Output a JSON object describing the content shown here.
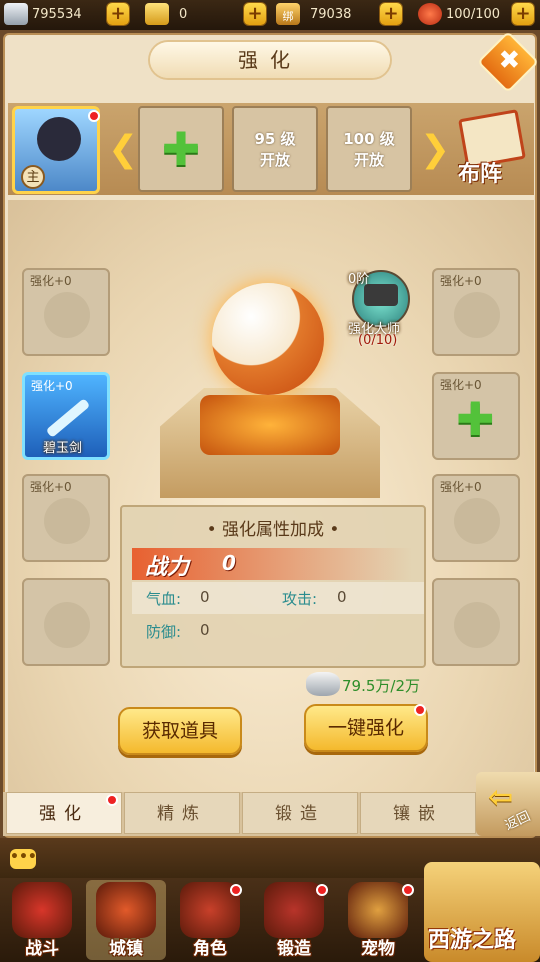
{
  "resources": {
    "silver": "795534",
    "gold": "0",
    "bound_gold_badge": "绑",
    "bound_gold": "79038",
    "stamina": "100/100"
  },
  "panel": {
    "title": "强化",
    "close_glyph": "✖"
  },
  "hero_strip": {
    "hero_badge": "主",
    "slots": [
      {
        "label": ""
      },
      {
        "label": "95 级\n开放"
      },
      {
        "label": "100 级\n开放"
      }
    ],
    "formation_label": "布阵",
    "arrow_left": "❮",
    "arrow_right": "❯"
  },
  "equip": {
    "slot_label": "强化+0",
    "sword_name": "碧玉剑",
    "master_rank": "0阶",
    "master_label": "强化大师",
    "master_progress": "(0/10)"
  },
  "stats": {
    "title": "• 强化属性加成 •",
    "power_label": "战力",
    "power_value": "0",
    "hp_label": "气血:",
    "hp_value": "0",
    "atk_label": "攻击:",
    "atk_value": "0",
    "def_label": "防御:",
    "def_value": "0"
  },
  "cost": "79.5万/2万",
  "buttons": {
    "get_items": "获取道具",
    "auto_enhance": "一键强化"
  },
  "tabs": [
    "强化",
    "精炼",
    "锻造",
    "镶嵌"
  ],
  "back_label": "返回",
  "nav": [
    {
      "label": "战斗",
      "color": "#d8362a"
    },
    {
      "label": "城镇",
      "color": "#e25a2a"
    },
    {
      "label": "角色",
      "color": "#c8402a"
    },
    {
      "label": "锻造",
      "color": "#b8342a"
    },
    {
      "label": "宠物",
      "color": "#e0a040"
    }
  ],
  "logo_text": "西游之路",
  "chat_glyph": "•••",
  "accent": {
    "gold": "#ffd34a",
    "green": "#53c23a",
    "red": "#e22222"
  }
}
